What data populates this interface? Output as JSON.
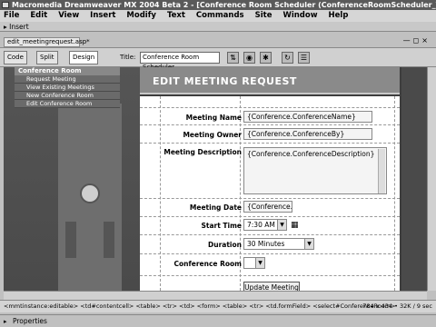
{
  "window": {
    "title": "Macromedia Dreamweaver MX 2004 Beta 2 - [Conference Room Scheduler (ConferenceRoomScheduler_VBS/e..."
  },
  "menu": [
    "File",
    "Edit",
    "View",
    "Insert",
    "Modify",
    "Text",
    "Commands",
    "Site",
    "Window",
    "Help"
  ],
  "insert_bar": {
    "label": "Insert"
  },
  "document_tab": {
    "label": "edit_meetingrequest.asp*"
  },
  "toolbar": {
    "code": "Code",
    "split": "Split",
    "design": "Design",
    "title_label": "Title:",
    "title_value": "Conference Room Scheduler"
  },
  "side_menu": {
    "header": "Conference Room",
    "items": [
      "Request Meeting",
      "View Existing Meetings",
      "New Conference Room",
      "Edit Conference Room"
    ]
  },
  "page_heading": "EDIT MEETING REQUEST",
  "form": {
    "meeting_name_label": "Meeting Name",
    "meeting_name_value": "{Conference.ConferenceName}",
    "meeting_owner_label": "Meeting Owner",
    "meeting_owner_value": "{Conference.ConferenceBy}",
    "meeting_description_label": "Meeting Description",
    "meeting_description_value": "{Conference.ConferenceDescription}",
    "meeting_date_label": "Meeting Date",
    "meeting_date_value": "{Conference.S",
    "start_time_label": "Start Time",
    "start_time_value": "7:30 AM",
    "duration_label": "Duration",
    "duration_value": "30 Minutes",
    "conference_room_label": "Conference Room",
    "conference_room_value": "",
    "update_button": "Update Meeting"
  },
  "status_bar": {
    "tag_path": "<mmtinstance:editable> <td#contentcell> <table> <tr> <td> <form> <table> <tr> <td.formField> <select#ConferenceRoom>",
    "info": "784 x 434 • 32K / 9 sec"
  },
  "properties_panel": {
    "label": "Properties"
  },
  "colors": {
    "titlebar": "#5a5a5a",
    "header": "#8a8a8a",
    "side_menu": "#6a6a6a"
  }
}
